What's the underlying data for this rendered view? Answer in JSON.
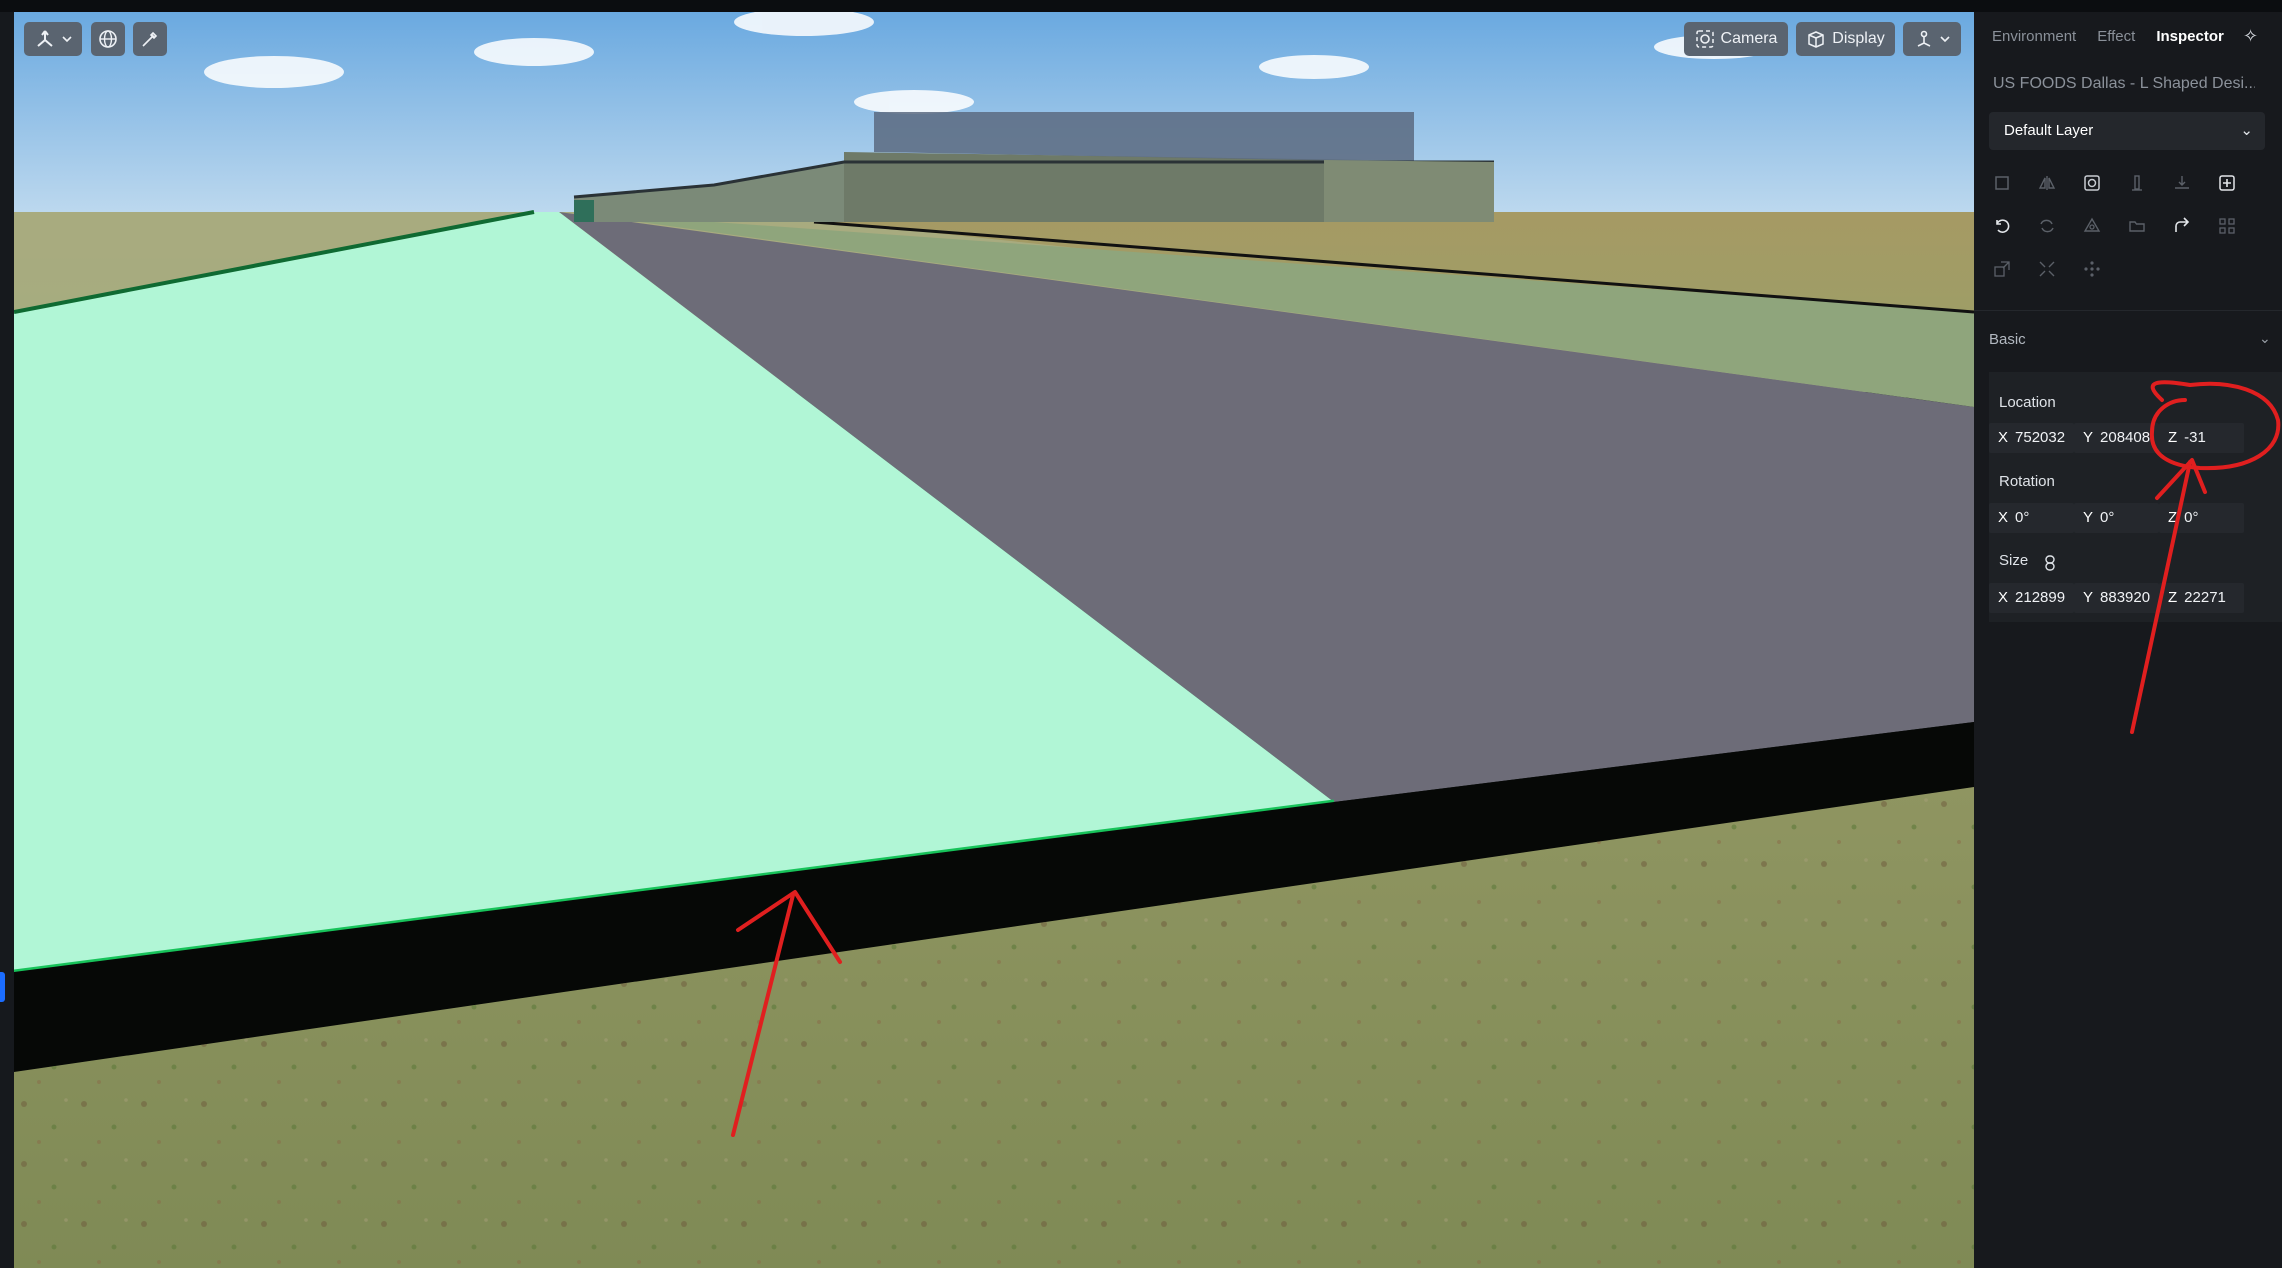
{
  "viewport_toolbar": {
    "camera_label": "Camera",
    "display_label": "Display"
  },
  "panel": {
    "tabs": [
      {
        "label": "Environment",
        "active": false
      },
      {
        "label": "Effect",
        "active": false
      },
      {
        "label": "Inspector",
        "active": true
      }
    ],
    "project_title": "US FOODS Dallas - L Shaped Desi...",
    "layer_select": "Default Layer",
    "section": "Basic",
    "location": {
      "label": "Location",
      "x_axis": "X",
      "x": "752032",
      "y_axis": "Y",
      "y": "208408",
      "z_axis": "Z",
      "z": "-31"
    },
    "rotation": {
      "label": "Rotation",
      "x_axis": "X",
      "x": "0°",
      "y_axis": "Y",
      "y": "0°",
      "z_axis": "Z",
      "z": "0°"
    },
    "size": {
      "label": "Size",
      "x_axis": "X",
      "x": "212899",
      "y_axis": "Y",
      "y": "883920",
      "z_axis": "Z",
      "z": "22271"
    }
  },
  "colors": {
    "accent": "#1b6dff",
    "annotation": "#e01f1f",
    "selected_slab": "#b1f6d6",
    "selection_outline": "#0f8a3c",
    "panel_bg": "#17191d"
  },
  "icons": [
    "transform-gizmo-icon",
    "globe-icon",
    "eyedropper-icon",
    "camera-icon",
    "display-icon",
    "pivot-icon",
    "sparkle-icon",
    "chevron-down-icon",
    "link-icon"
  ]
}
